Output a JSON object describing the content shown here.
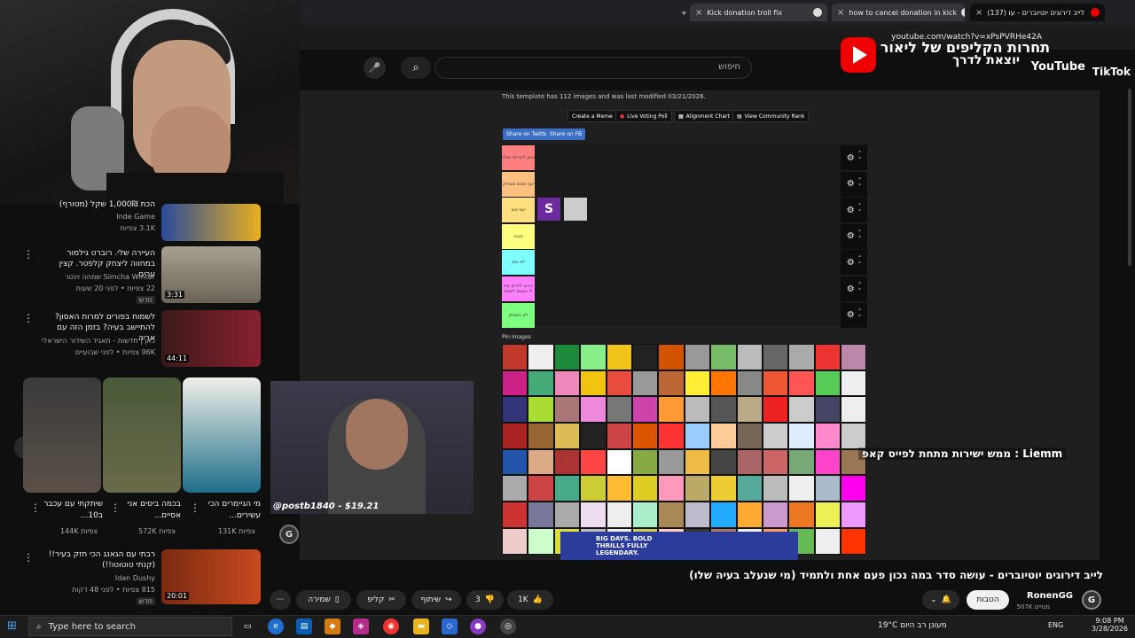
{
  "browser": {
    "tabs": [
      {
        "label": "Kick donation troll fix"
      },
      {
        "label": "how to cancel donation in kick"
      },
      {
        "label": "(137) לייב דירוגים יוטיוברים - עו"
      }
    ],
    "url": "youtube.com/watch?v=xPsPVRHe42A"
  },
  "header": {
    "search_placeholder": "חיפוש"
  },
  "overlay": {
    "tiktok_line1": "תחרות הקליפים של ליאור",
    "tiktok_line2": "יוצאת לדרך",
    "youtube_word": "YouTube",
    "tiktok_word": "TikTok"
  },
  "tiermaker": {
    "template_info": "This template has 112 images and was last modified 03/21/2026.",
    "buttons": [
      "Create a Meme",
      "Live Voting Poll",
      "Alignment Chart",
      "View Community Rank"
    ],
    "share_twitter": "Share on Twitter",
    "share_fb": "Share on FB",
    "pin_label": "Pin Images",
    "tiers": [
      {
        "label": "נוגע לקריזה שלה",
        "color": "#ff7f7f"
      },
      {
        "label": "יעני מטש מצחיק",
        "color": "#ffbf7f"
      },
      {
        "label": "יעני טוב",
        "color": "#ffdf7f"
      },
      {
        "label": "בינוני",
        "color": "#ffff7f"
      },
      {
        "label": "לא טוב",
        "color": "#7fffff"
      },
      {
        "label": "הרוב לזרוק את לי בעצם לשבת",
        "color": "#ff7fff"
      },
      {
        "label": "לא בצחוק",
        "color": "#7fff7f"
      }
    ],
    "grid_colors": [
      "#c0392b",
      "#eee",
      "#1b8a3a",
      "#8e8",
      "#f0c419",
      "#222",
      "#d35400",
      "#999",
      "#7b6",
      "#bbb",
      "#666",
      "#aaa",
      "#e33",
      "#b8a",
      "#c28",
      "#4a7",
      "#e8b",
      "#f1c40f",
      "#e74c3c",
      "#999",
      "#b63",
      "#fe3",
      "#f70",
      "#888",
      "#e53",
      "#f55",
      "#5c5",
      "#eee",
      "#337",
      "#ad3",
      "#a77",
      "#e8d",
      "#777",
      "#c4a",
      "#f93",
      "#bbb",
      "#555",
      "#ba8",
      "#e22",
      "#ccc",
      "#446",
      "#eee",
      "#a22",
      "#963",
      "#db5",
      "#222",
      "#c44",
      "#d50",
      "#f33",
      "#9cf",
      "#fc9",
      "#765",
      "#ccc",
      "#def",
      "#f8c",
      "#ccc",
      "#25a",
      "#da8",
      "#a33",
      "#f44",
      "#fff",
      "#8a4",
      "#999",
      "#eb4",
      "#444",
      "#a66",
      "#c66",
      "#7a7",
      "#f4c",
      "#975",
      "#aaa",
      "#c44",
      "#4a8",
      "#cc3",
      "#fb3",
      "#dc2",
      "#f9b",
      "#ba6",
      "#ec3",
      "#5a9",
      "#bbb",
      "#eee",
      "#abc",
      "#f0e",
      "#c33",
      "#779",
      "#aaa",
      "#ede",
      "#eee",
      "#aec",
      "#a85",
      "#bbc",
      "#2af",
      "#fa3",
      "#c9c",
      "#e72",
      "#ee5",
      "#e9f",
      "#ecc",
      "#cfc",
      "#dd3",
      "#bbb",
      "#eee",
      "#cc5",
      "#fcc",
      "#333",
      "#a76",
      "#eee",
      "#f96",
      "#6b5",
      "#eee",
      "#f30"
    ]
  },
  "player": {
    "donation": "@postb1840 - $19.21",
    "chat_user": "Liemm",
    "chat_message": "ממש ישירות מתחת לפייס קאפ",
    "ad_text": "BIG DAYS. BOLD THRILLS FULLY LEGENDARY."
  },
  "video": {
    "title": "לייב דירוגים יוטיוברים - עושה סדר במה נכון פעם אחת ולתמיד (מי שנעלב בעיה שלו)",
    "channel_name": "RonenGG",
    "channel_subs": "507K מנויים",
    "subscribe_label": "הטבות",
    "like_count": "1K",
    "dislike_count": "3",
    "share_label": "שיתוף",
    "clip_label": "קליפ",
    "save_label": "שמירה"
  },
  "sidebar": {
    "items": [
      {
        "title": "הכת 1,000₪ שקל (מטורף)",
        "channel": "Inde Game",
        "meta": "3.1K צפיות",
        "duration": ""
      },
      {
        "title": "העיירה שלי. רוברט גילמור במחווה ליצחק קלפטר. קצין ערים.",
        "channel": "Simcha Winter שמחה וינטר",
        "meta": "22 צפיות • לפני 20 שעות",
        "badge": "חדש",
        "duration": "3:31"
      },
      {
        "title": "לשמוח בפורים למרות האסון? להתיישב בעיה? בזמן הזה עם אריה...",
        "channel": "כאן | חדשות - תאגיד השידור הישראלי",
        "meta": "96K צפיות • לפני שבועיים",
        "duration": "44:11"
      },
      {
        "title": "רבתי עם הגאנג הכי חזק בעיר!! (קנתי טוטוטו!!)",
        "channel": "Idan Dushy",
        "meta": "815 צפיות • לפני 48 דקות",
        "badge": "חדש",
        "duration": "20:01"
      }
    ],
    "shorts": [
      {
        "title": "שיתקתי עם עכבר ב10...",
        "views": "144K צפיות"
      },
      {
        "title": "בכמה ביסים אני אסיים...",
        "views": "572K צפיות"
      },
      {
        "title": "מי הגיימרים הכי עשירים...",
        "views": "131K צפיות"
      }
    ]
  },
  "taskbar": {
    "search_placeholder": "Type here to search",
    "weather": "19°C מעונן רב היום",
    "lang": "ENG",
    "time": "9:08 PM",
    "date": "3/28/2026"
  }
}
